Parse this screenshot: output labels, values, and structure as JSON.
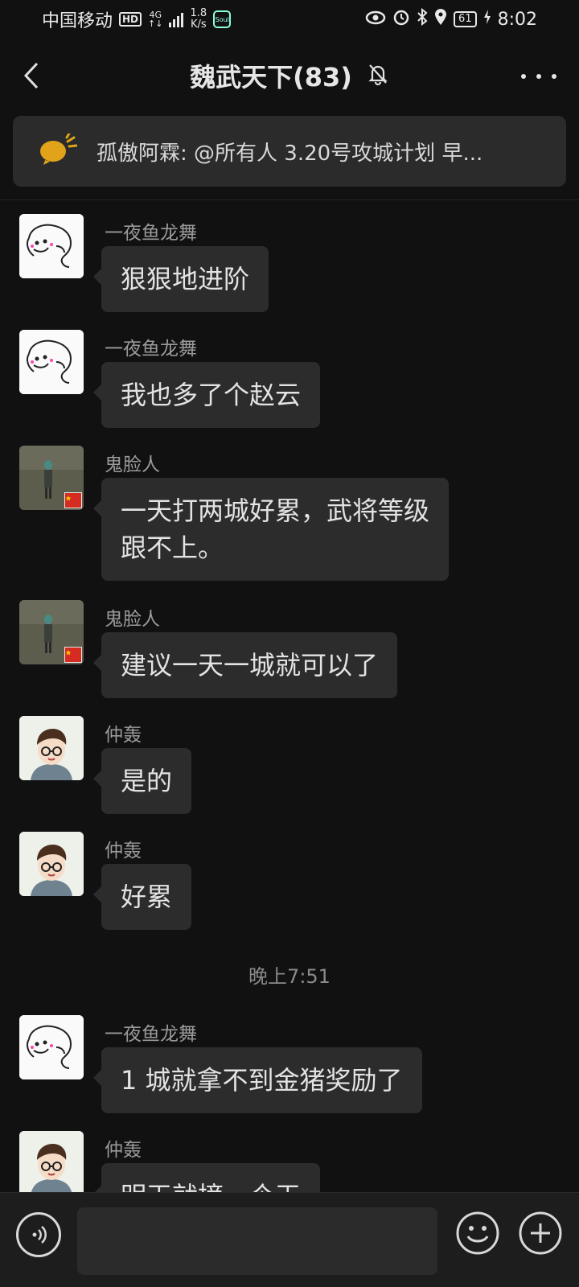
{
  "status_bar": {
    "carrier": "中国移动",
    "hd": "HD",
    "network_top": "4G",
    "network_bottom": "↑↓",
    "speed_value": "1.8",
    "speed_unit": "K/s",
    "app_badge": "Soul",
    "battery": "61",
    "time": "8:02"
  },
  "header": {
    "title": "魏武天下(83)"
  },
  "announcement": {
    "text": "孤傲阿霖: @所有人 3.20号攻城计划 早..."
  },
  "messages": [
    {
      "sender": "一夜鱼龙舞",
      "avatar": "cartoon-doodle-avatar",
      "lines": [
        "狠狠地进阶"
      ]
    },
    {
      "sender": "一夜鱼龙舞",
      "avatar": "cartoon-doodle-avatar",
      "lines": [
        "我也多了个赵云"
      ]
    },
    {
      "sender": "鬼脸人",
      "avatar": "photo-avatar-with-flag",
      "lines": [
        "一天打两城好累，武将等级",
        "跟不上。"
      ]
    },
    {
      "sender": "鬼脸人",
      "avatar": "photo-avatar-with-flag",
      "lines": [
        "建议一天一城就可以了"
      ]
    },
    {
      "sender": "仲轰",
      "avatar": "cartoon-boy-avatar",
      "lines": [
        "是的"
      ]
    },
    {
      "sender": "仲轰",
      "avatar": "cartoon-boy-avatar",
      "lines": [
        "好累"
      ]
    },
    {
      "sender": "一夜鱼龙舞",
      "avatar": "cartoon-doodle-avatar",
      "lines": [
        "1 城就拿不到金猪奖励了"
      ]
    },
    {
      "sender": "仲轰",
      "avatar": "cartoon-boy-avatar",
      "lines": [
        "明天就摘一个天"
      ]
    }
  ],
  "timestamp": "晚上7:51",
  "input_bar": {
    "input_value": ""
  }
}
